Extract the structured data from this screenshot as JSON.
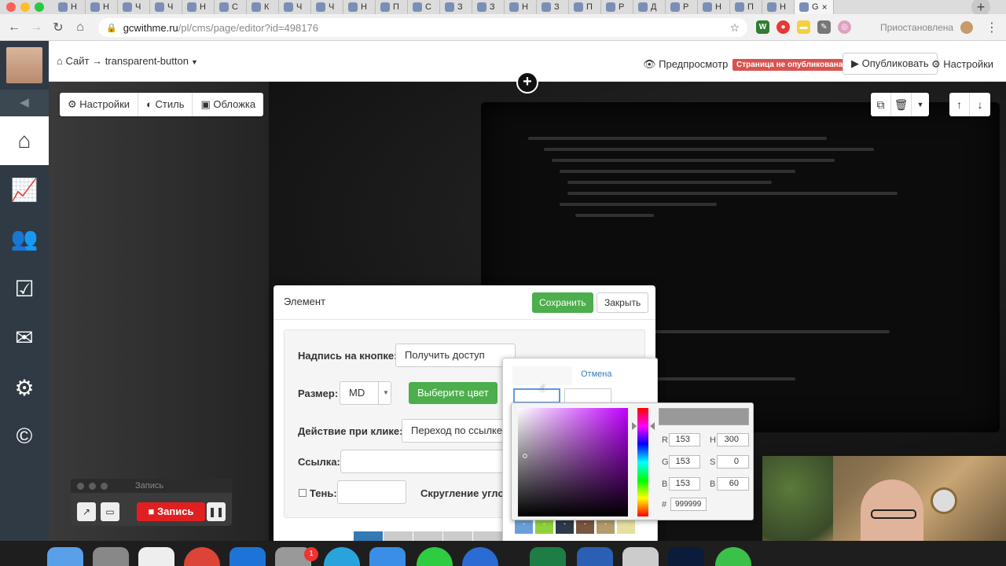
{
  "browser": {
    "tabs": [
      {
        "label": "Н"
      },
      {
        "label": "Н"
      },
      {
        "label": "Ч"
      },
      {
        "label": "Ч"
      },
      {
        "label": "Н"
      },
      {
        "label": "С"
      },
      {
        "label": "К"
      },
      {
        "label": "Ч"
      },
      {
        "label": "Ч"
      },
      {
        "label": "Н"
      },
      {
        "label": "П"
      },
      {
        "label": "С"
      },
      {
        "label": "З"
      },
      {
        "label": "З"
      },
      {
        "label": "Н"
      },
      {
        "label": "З"
      },
      {
        "label": "П"
      },
      {
        "label": "Р"
      },
      {
        "label": "Д"
      },
      {
        "label": "Р"
      },
      {
        "label": "Н"
      },
      {
        "label": "П"
      },
      {
        "label": "Н"
      },
      {
        "label": "G"
      }
    ],
    "url_host": "gcwithme.ru",
    "url_path": "/pl/cms/page/editor?id=498176",
    "paused_label": "Приостановлена"
  },
  "editor": {
    "breadcrumb": "Сайт → transparent-button",
    "preview_label": "Предпросмотр",
    "unpublished_badge": "Страница не опубликована",
    "publish_label": "Опубликовать",
    "settings_label": "Настройки"
  },
  "block_toolbar": {
    "settings": "Настройки",
    "style": "Стиль",
    "cover": "Обложка"
  },
  "modal": {
    "title": "Элемент",
    "save_label": "Сохранить",
    "close_label": "Закрыть",
    "button_text_label": "Надпись на кнопке:",
    "button_text_value": "Получить доступ",
    "size_label": "Размер:",
    "size_value": "MD",
    "choose_color_label": "Выберите цвет",
    "click_action_label": "Действие при клике:",
    "click_action_value": "Переход по ссылке",
    "link_label": "Ссылка:",
    "shadow_label": "Тень:",
    "rounding_label": "Скругление угло"
  },
  "color_picker": {
    "cancel_label": "Отмена",
    "r_label": "R",
    "r_value": "153",
    "g_label": "G",
    "g_value": "153",
    "b_label": "B",
    "b_value": "153",
    "h_label": "H",
    "h_value": "300",
    "s_label": "S",
    "s_value": "0",
    "v_label": "B",
    "v_value": "60",
    "hex_label": "#",
    "hex_value": "999999",
    "preview_color": "#999999",
    "swatches": [
      "#6aa0d8",
      "#8fd13a",
      "#2d3a4a",
      "#7a5540",
      "#b39b6a",
      "#e6e0a0"
    ]
  },
  "recorder": {
    "title": "Запись",
    "record_label": "Запись"
  },
  "dock": {
    "badge_count": "1"
  }
}
